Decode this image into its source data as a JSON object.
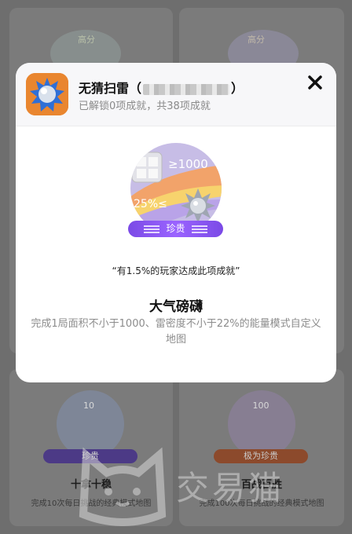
{
  "background": {
    "top_left_badge_label": "高分",
    "top_right_badge_label": "高分",
    "cards": [
      {
        "pill": "珍贵",
        "title": "十拿十稳",
        "desc": "完成10次每日挑战的经典模式地图",
        "badge_number": "10"
      },
      {
        "pill": "极为珍贵",
        "title": "百战百胜",
        "desc": "完成100次每日挑战的经典模式地图",
        "badge_number": "100"
      }
    ],
    "watermark_text": "交易猫"
  },
  "modal": {
    "game_title": "无猜扫雷",
    "title_open_paren": "（",
    "title_close_paren": "）",
    "unlock_status": "已解锁0项成就，共38项成就",
    "badge_text_top": "≥1000",
    "badge_text_bottom": "25%≤",
    "rarity_label": "珍贵",
    "rarity_percent_text": "“有1.5%的玩家达成此项成就”",
    "achievement_name": "大气磅礴",
    "achievement_desc": "完成1局面积不小于1000、雷密度不小于22%的能量模式自定义地图"
  },
  "colors": {
    "rarity_purple": "#8a55f2",
    "very_rare_orange": "#e35d2a",
    "app_icon_orange": "#e87b2b"
  }
}
